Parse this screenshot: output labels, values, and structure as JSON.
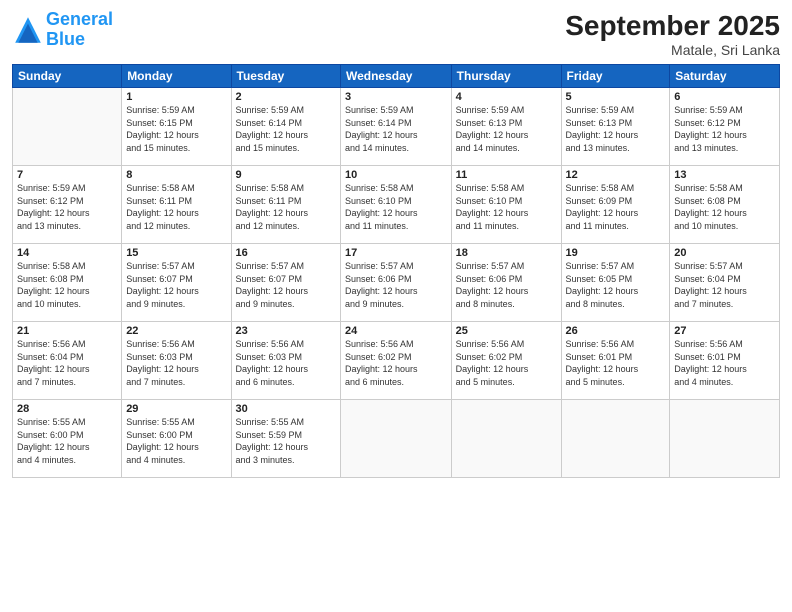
{
  "logo": {
    "line1": "General",
    "line2": "Blue"
  },
  "title": "September 2025",
  "location": "Matale, Sri Lanka",
  "days_header": [
    "Sunday",
    "Monday",
    "Tuesday",
    "Wednesday",
    "Thursday",
    "Friday",
    "Saturday"
  ],
  "weeks": [
    [
      {
        "day": "",
        "sunrise": "",
        "sunset": "",
        "daylight": ""
      },
      {
        "day": "1",
        "sunrise": "Sunrise: 5:59 AM",
        "sunset": "Sunset: 6:15 PM",
        "daylight": "Daylight: 12 hours and 15 minutes."
      },
      {
        "day": "2",
        "sunrise": "Sunrise: 5:59 AM",
        "sunset": "Sunset: 6:14 PM",
        "daylight": "Daylight: 12 hours and 15 minutes."
      },
      {
        "day": "3",
        "sunrise": "Sunrise: 5:59 AM",
        "sunset": "Sunset: 6:14 PM",
        "daylight": "Daylight: 12 hours and 14 minutes."
      },
      {
        "day": "4",
        "sunrise": "Sunrise: 5:59 AM",
        "sunset": "Sunset: 6:13 PM",
        "daylight": "Daylight: 12 hours and 14 minutes."
      },
      {
        "day": "5",
        "sunrise": "Sunrise: 5:59 AM",
        "sunset": "Sunset: 6:13 PM",
        "daylight": "Daylight: 12 hours and 13 minutes."
      },
      {
        "day": "6",
        "sunrise": "Sunrise: 5:59 AM",
        "sunset": "Sunset: 6:12 PM",
        "daylight": "Daylight: 12 hours and 13 minutes."
      }
    ],
    [
      {
        "day": "7",
        "sunrise": "Sunrise: 5:59 AM",
        "sunset": "Sunset: 6:12 PM",
        "daylight": "Daylight: 12 hours and 13 minutes."
      },
      {
        "day": "8",
        "sunrise": "Sunrise: 5:58 AM",
        "sunset": "Sunset: 6:11 PM",
        "daylight": "Daylight: 12 hours and 12 minutes."
      },
      {
        "day": "9",
        "sunrise": "Sunrise: 5:58 AM",
        "sunset": "Sunset: 6:11 PM",
        "daylight": "Daylight: 12 hours and 12 minutes."
      },
      {
        "day": "10",
        "sunrise": "Sunrise: 5:58 AM",
        "sunset": "Sunset: 6:10 PM",
        "daylight": "Daylight: 12 hours and 11 minutes."
      },
      {
        "day": "11",
        "sunrise": "Sunrise: 5:58 AM",
        "sunset": "Sunset: 6:10 PM",
        "daylight": "Daylight: 12 hours and 11 minutes."
      },
      {
        "day": "12",
        "sunrise": "Sunrise: 5:58 AM",
        "sunset": "Sunset: 6:09 PM",
        "daylight": "Daylight: 12 hours and 11 minutes."
      },
      {
        "day": "13",
        "sunrise": "Sunrise: 5:58 AM",
        "sunset": "Sunset: 6:08 PM",
        "daylight": "Daylight: 12 hours and 10 minutes."
      }
    ],
    [
      {
        "day": "14",
        "sunrise": "Sunrise: 5:58 AM",
        "sunset": "Sunset: 6:08 PM",
        "daylight": "Daylight: 12 hours and 10 minutes."
      },
      {
        "day": "15",
        "sunrise": "Sunrise: 5:57 AM",
        "sunset": "Sunset: 6:07 PM",
        "daylight": "Daylight: 12 hours and 9 minutes."
      },
      {
        "day": "16",
        "sunrise": "Sunrise: 5:57 AM",
        "sunset": "Sunset: 6:07 PM",
        "daylight": "Daylight: 12 hours and 9 minutes."
      },
      {
        "day": "17",
        "sunrise": "Sunrise: 5:57 AM",
        "sunset": "Sunset: 6:06 PM",
        "daylight": "Daylight: 12 hours and 9 minutes."
      },
      {
        "day": "18",
        "sunrise": "Sunrise: 5:57 AM",
        "sunset": "Sunset: 6:06 PM",
        "daylight": "Daylight: 12 hours and 8 minutes."
      },
      {
        "day": "19",
        "sunrise": "Sunrise: 5:57 AM",
        "sunset": "Sunset: 6:05 PM",
        "daylight": "Daylight: 12 hours and 8 minutes."
      },
      {
        "day": "20",
        "sunrise": "Sunrise: 5:57 AM",
        "sunset": "Sunset: 6:04 PM",
        "daylight": "Daylight: 12 hours and 7 minutes."
      }
    ],
    [
      {
        "day": "21",
        "sunrise": "Sunrise: 5:56 AM",
        "sunset": "Sunset: 6:04 PM",
        "daylight": "Daylight: 12 hours and 7 minutes."
      },
      {
        "day": "22",
        "sunrise": "Sunrise: 5:56 AM",
        "sunset": "Sunset: 6:03 PM",
        "daylight": "Daylight: 12 hours and 7 minutes."
      },
      {
        "day": "23",
        "sunrise": "Sunrise: 5:56 AM",
        "sunset": "Sunset: 6:03 PM",
        "daylight": "Daylight: 12 hours and 6 minutes."
      },
      {
        "day": "24",
        "sunrise": "Sunrise: 5:56 AM",
        "sunset": "Sunset: 6:02 PM",
        "daylight": "Daylight: 12 hours and 6 minutes."
      },
      {
        "day": "25",
        "sunrise": "Sunrise: 5:56 AM",
        "sunset": "Sunset: 6:02 PM",
        "daylight": "Daylight: 12 hours and 5 minutes."
      },
      {
        "day": "26",
        "sunrise": "Sunrise: 5:56 AM",
        "sunset": "Sunset: 6:01 PM",
        "daylight": "Daylight: 12 hours and 5 minutes."
      },
      {
        "day": "27",
        "sunrise": "Sunrise: 5:56 AM",
        "sunset": "Sunset: 6:01 PM",
        "daylight": "Daylight: 12 hours and 4 minutes."
      }
    ],
    [
      {
        "day": "28",
        "sunrise": "Sunrise: 5:55 AM",
        "sunset": "Sunset: 6:00 PM",
        "daylight": "Daylight: 12 hours and 4 minutes."
      },
      {
        "day": "29",
        "sunrise": "Sunrise: 5:55 AM",
        "sunset": "Sunset: 6:00 PM",
        "daylight": "Daylight: 12 hours and 4 minutes."
      },
      {
        "day": "30",
        "sunrise": "Sunrise: 5:55 AM",
        "sunset": "Sunset: 5:59 PM",
        "daylight": "Daylight: 12 hours and 3 minutes."
      },
      {
        "day": "",
        "sunrise": "",
        "sunset": "",
        "daylight": ""
      },
      {
        "day": "",
        "sunrise": "",
        "sunset": "",
        "daylight": ""
      },
      {
        "day": "",
        "sunrise": "",
        "sunset": "",
        "daylight": ""
      },
      {
        "day": "",
        "sunrise": "",
        "sunset": "",
        "daylight": ""
      }
    ]
  ]
}
